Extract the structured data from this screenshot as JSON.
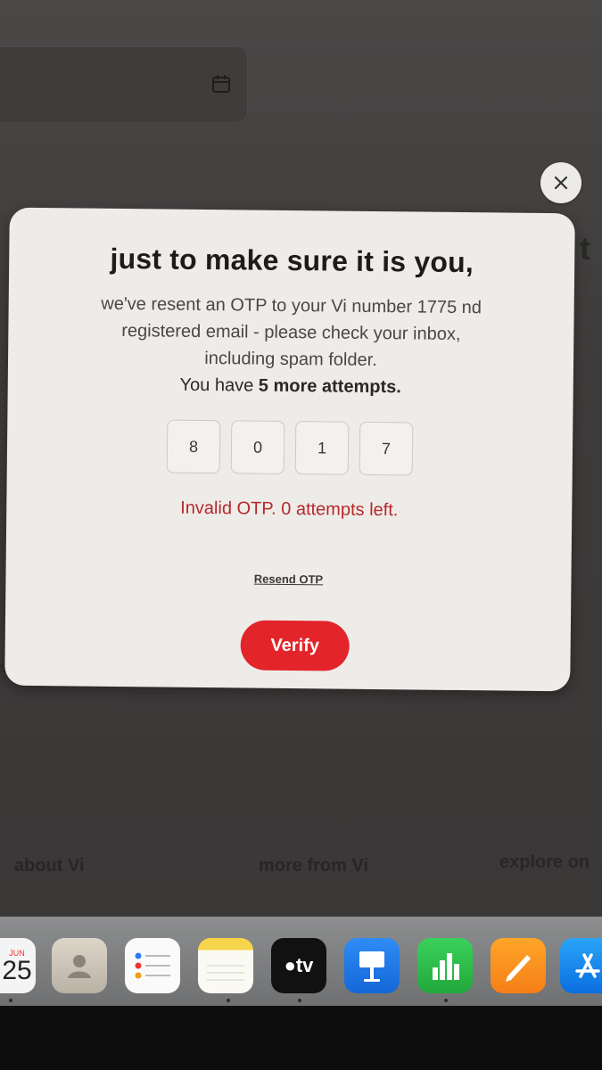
{
  "background": {
    "calendar_icon": "calendar-icon"
  },
  "modal": {
    "close_icon": "close-icon",
    "title": "just to make sure it is you,",
    "body_lines": [
      "we've resent an OTP to your Vi number 1775 nd",
      "registered email - please check your inbox,",
      "including spam folder."
    ],
    "attempts_prefix": "You have ",
    "attempts_bold": "5 more attempts.",
    "otp_digits": [
      "8",
      "0",
      "1",
      "7"
    ],
    "error": "Invalid OTP. 0 attempts left.",
    "resend_label": "Resend OTP",
    "verify_label": "Verify",
    "accent_color": "#e3242b",
    "error_color": "#b7272c"
  },
  "footer": {
    "about": "about Vi",
    "more": "more from Vi",
    "explore": "explore on"
  },
  "dock": {
    "calendar_day": "25",
    "calendar_month": "JUN",
    "tv_label": "tv",
    "apps": [
      "calendar-icon",
      "contacts-icon",
      "reminders-icon",
      "notes-icon",
      "apple-tv-icon",
      "keynote-icon",
      "numbers-icon",
      "pages-icon",
      "app-store-icon"
    ]
  }
}
